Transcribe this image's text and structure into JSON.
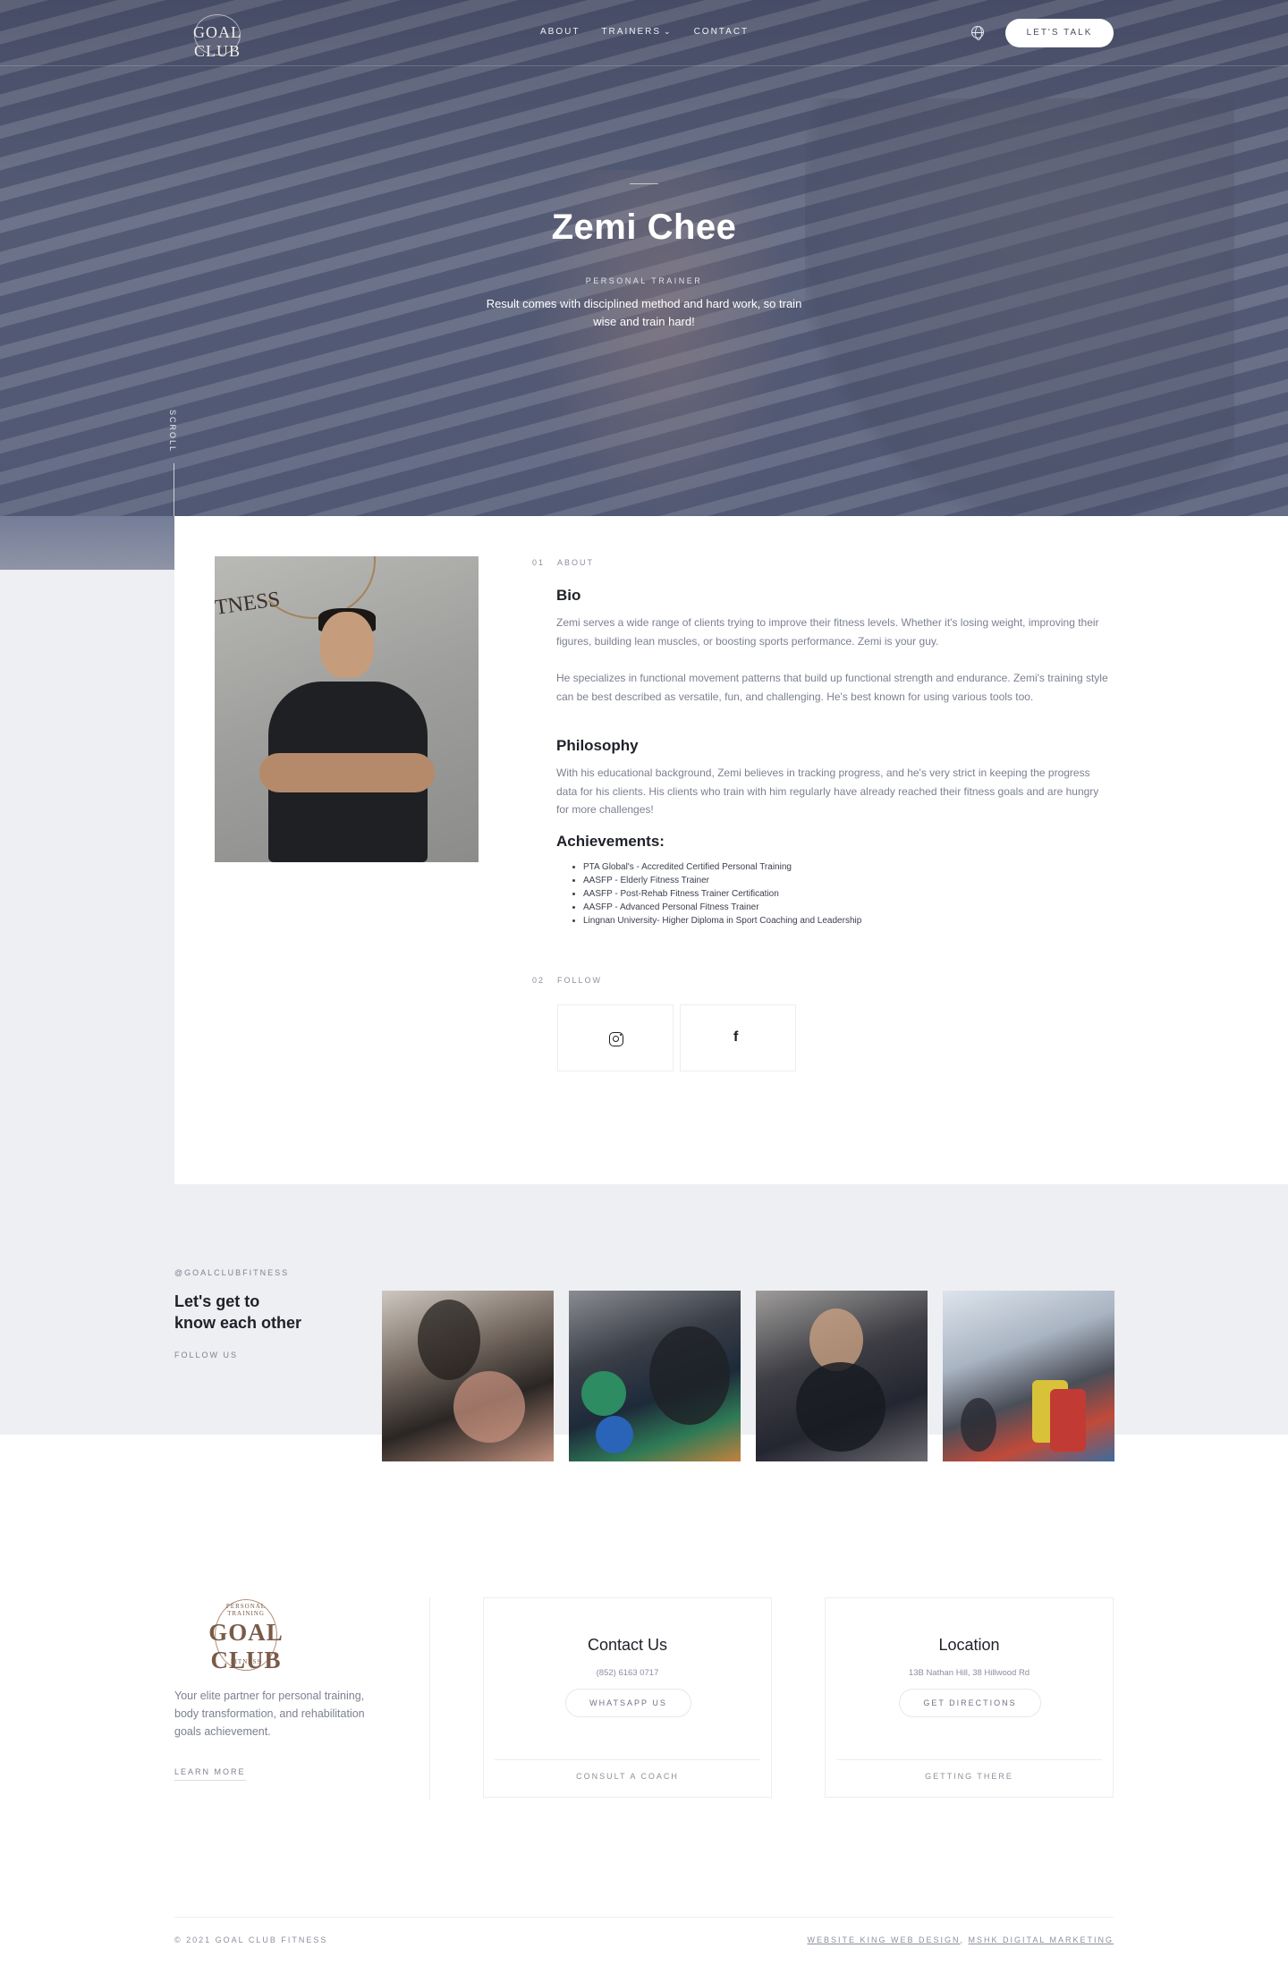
{
  "brand": {
    "logo_text": "GOAL CLUB",
    "logo_arc_top": "PERSONAL TRAINING",
    "logo_arc_bottom": "FITNESS"
  },
  "nav": {
    "links": [
      "ABOUT",
      "TRAINERS",
      "CONTACT"
    ],
    "lang_icon": "globe-icon",
    "cta": "LET'S TALK"
  },
  "hero": {
    "name": "Zemi Chee",
    "role": "PERSONAL TRAINER",
    "quote": "Result comes with disciplined method and hard work, so train wise and train hard!",
    "scroll": "SCROLL"
  },
  "about": {
    "label_num": "01",
    "label": "ABOUT",
    "bio_title": "Bio",
    "bio_p1": "Zemi serves a wide range of clients trying to improve their fitness levels. Whether it's losing weight, improving their figures, building lean muscles, or boosting sports performance. Zemi is your guy.",
    "bio_p2": "He specializes in functional movement patterns that build up functional strength and endurance. Zemi's training style can be best described as versatile, fun, and challenging. He's best known for using various tools too.",
    "philosophy_title": "Philosophy",
    "philosophy_text": "With his educational background, Zemi believes in tracking progress, and he's very strict in keeping the progress data for his clients. His clients who train with him regularly have already reached their fitness goals and are hungry for more challenges!",
    "achievements_title": "Achievements:",
    "achievements": [
      "PTA Global's - Accredited Certified Personal Training",
      "AASFP - Elderly Fitness Trainer",
      "AASFP - Post-Rehab Fitness Trainer Certification",
      "AASFP - Advanced Personal Fitness Trainer",
      "Lingnan University- Higher Diploma in Sport Coaching and Leadership"
    ]
  },
  "follow": {
    "label_num": "02",
    "label": "FOLLOW",
    "icons": [
      "instagram-icon",
      "facebook-icon"
    ]
  },
  "instagram": {
    "handle": "@GOALCLUBFITNESS",
    "title_line1": "Let's get to",
    "title_line2": "know each other",
    "follow": "FOLLOW US"
  },
  "footer": {
    "tagline": "Your elite partner for personal training, body transformation, and rehabilitation goals achievement.",
    "learn_more": "LEARN MORE",
    "contact": {
      "title": "Contact Us",
      "phone": "(852) 6163 0717",
      "button": "WHATSAPP US",
      "link": "CONSULT A COACH"
    },
    "location": {
      "title": "Location",
      "address": "13B Nathan Hill, 38 Hillwood Rd",
      "button": "GET DIRECTIONS",
      "link": "GETTING THERE"
    },
    "copyright": "© 2021 GOAL CLUB FITNESS",
    "credit_1": "WEBSITE KING WEB DESIGN",
    "credit_2": "MSHK DIGITAL MARKETING"
  },
  "colors": {
    "accent_brown": "#7a5a48",
    "hero_overlay": "#465276",
    "panel_grey": "#eeeff3"
  }
}
